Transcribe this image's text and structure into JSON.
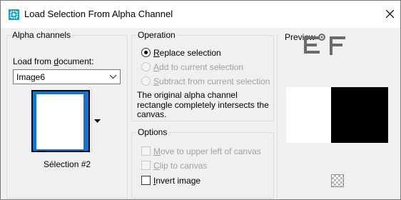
{
  "window": {
    "title": "Load Selection From Alpha Channel",
    "close_icon": "close-icon",
    "app_icon": "selection-app-icon"
  },
  "alpha_channels": {
    "group_label": "Alpha channels",
    "load_from_label_pre": "Load from ",
    "load_from_label_u": "d",
    "load_from_label_post": "ocument:",
    "document_selected": "Image6",
    "selection_caption": "Sélection #2"
  },
  "operation": {
    "group_label": "Operation",
    "options": [
      {
        "label_u": "R",
        "label_rest": "eplace selection",
        "selected": true,
        "enabled": true
      },
      {
        "label_u": "A",
        "label_rest": "dd to current selection",
        "selected": false,
        "enabled": false
      },
      {
        "label_u": "S",
        "label_rest": "ubtract from current selection",
        "selected": false,
        "enabled": false
      }
    ],
    "description": [
      "The original alpha channel",
      "rectangle completely intersects the",
      "canvas."
    ]
  },
  "options": {
    "group_label": "Options",
    "items": [
      {
        "label_u": "M",
        "label_rest": "ove to upper left of canvas",
        "checked": false,
        "enabled": false
      },
      {
        "label_u": "C",
        "label_rest": "lip to canvas",
        "checked": false,
        "enabled": false
      },
      {
        "label_u": "I",
        "label_rest": "nvert image",
        "checked": false,
        "enabled": true
      }
    ]
  },
  "preview": {
    "group_label": "Preview",
    "watermark": "EF",
    "background_toggle_icon": "checkerboard-icon"
  }
}
